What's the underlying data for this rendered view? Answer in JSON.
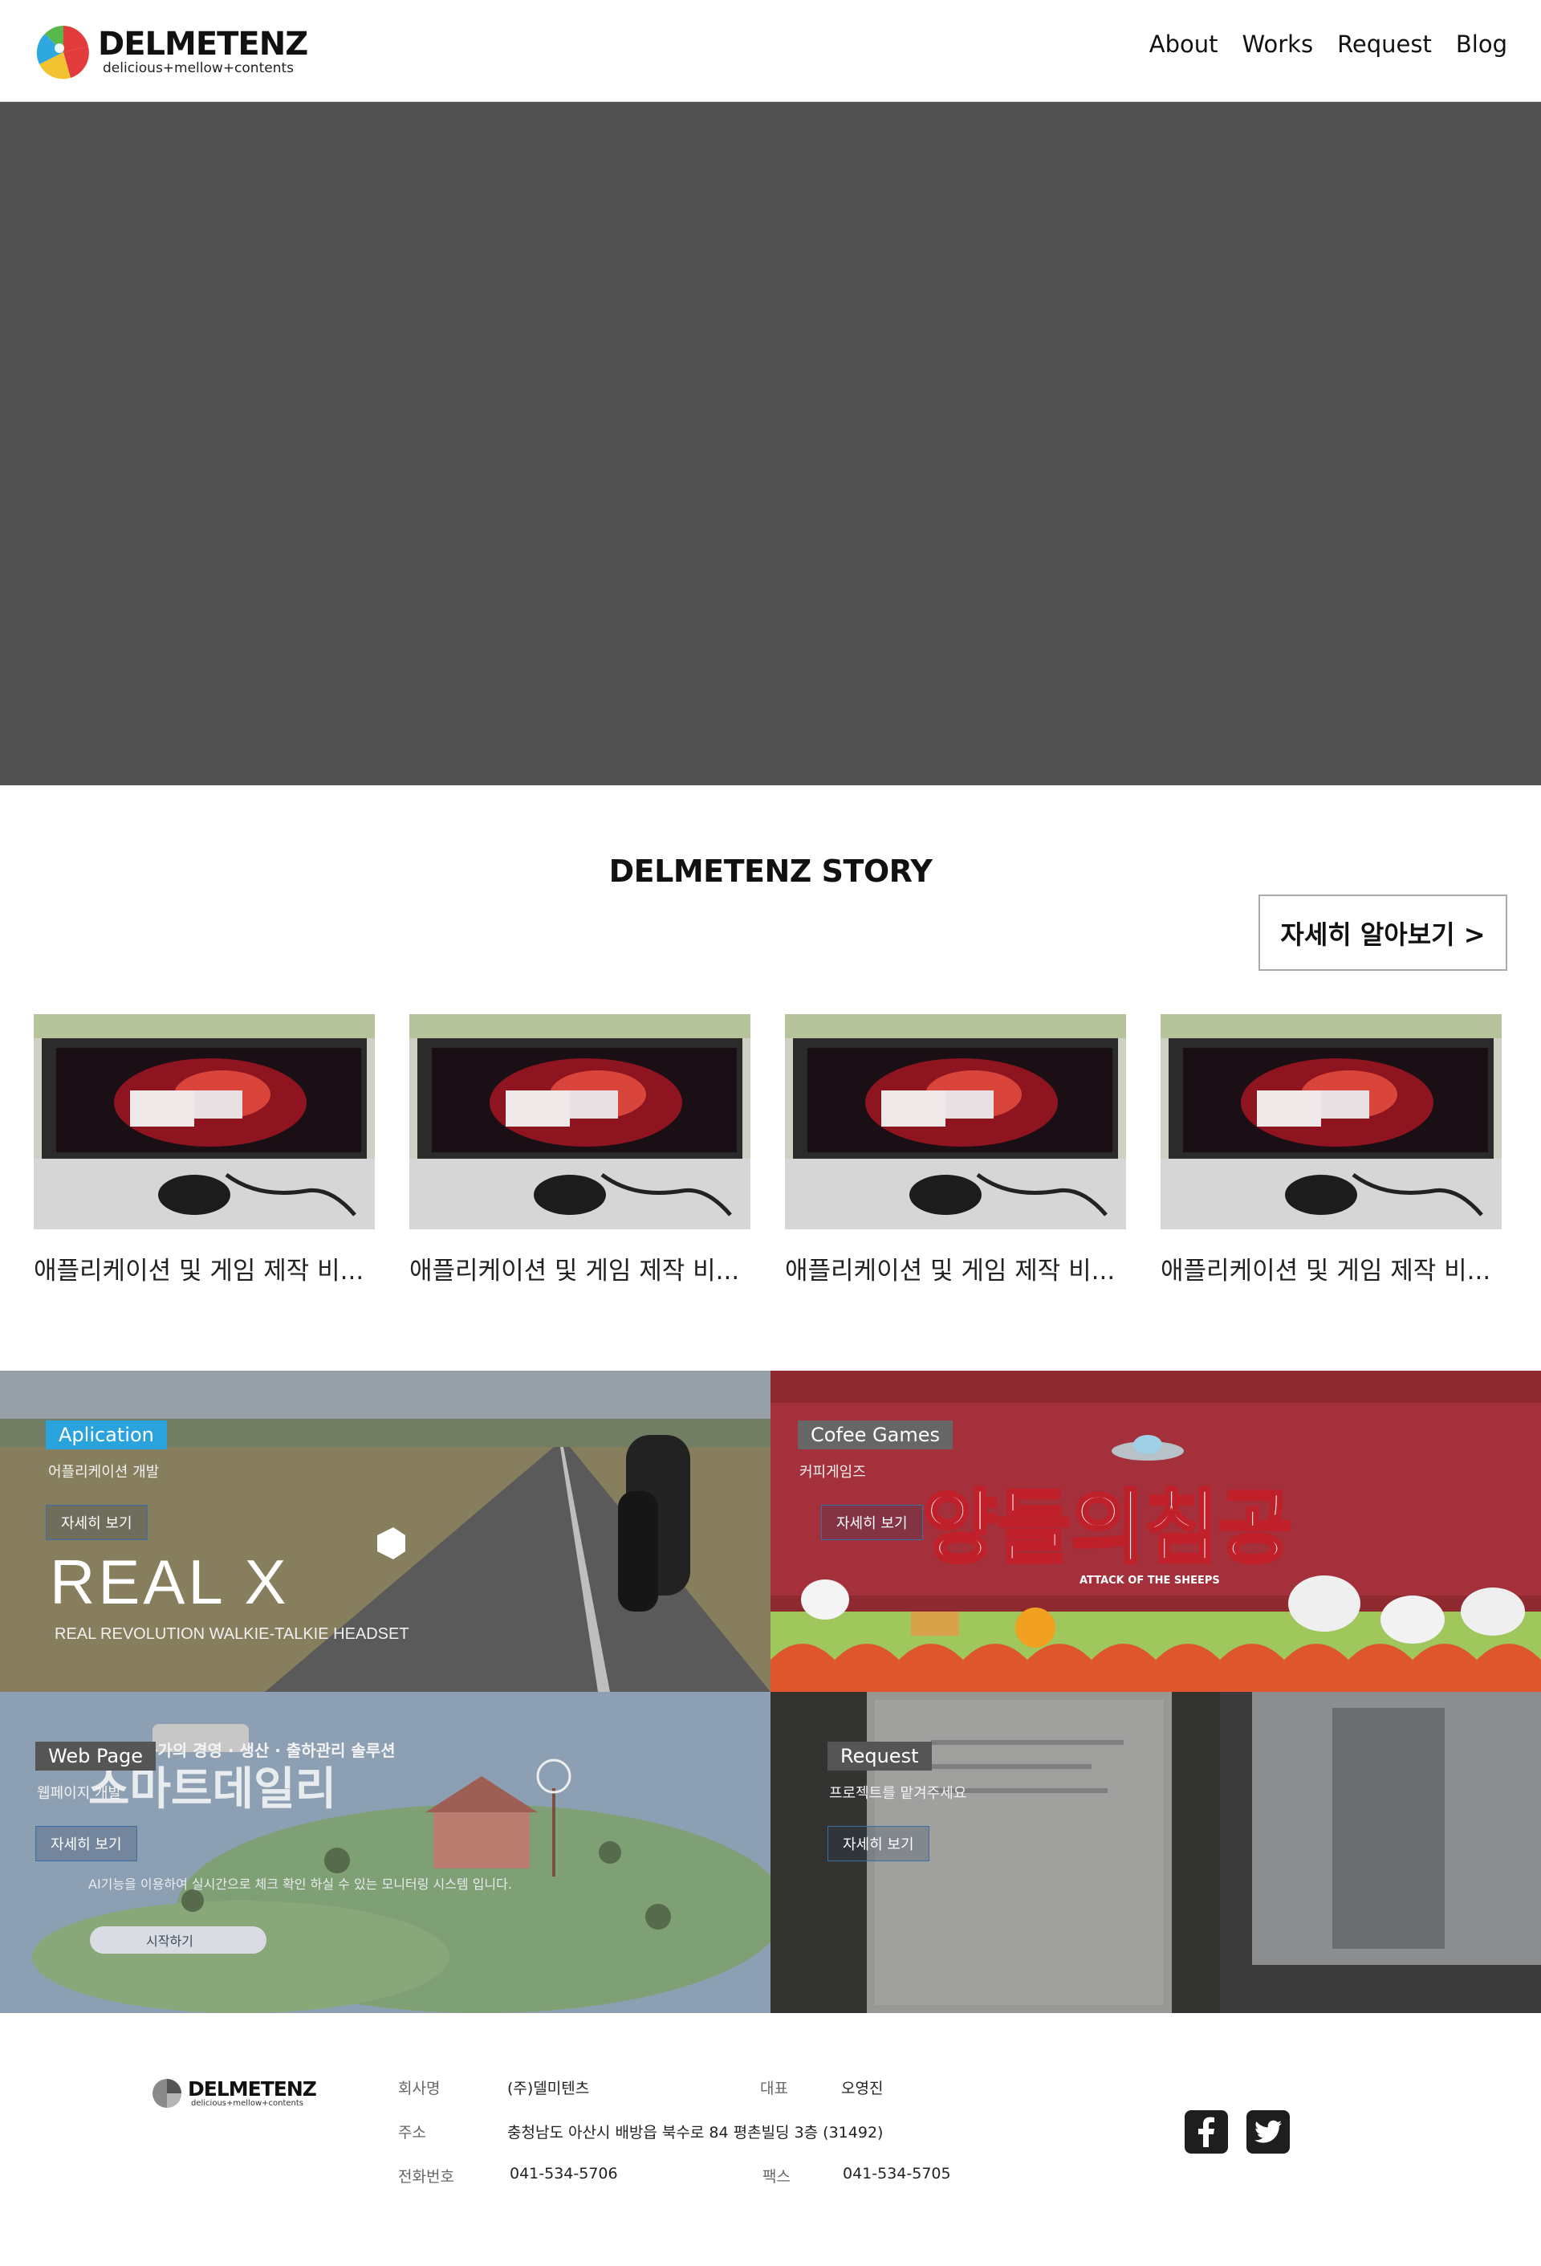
{
  "header": {
    "brand_name": "DELMETENZ",
    "brand_tagline": "delicious+mellow+contents",
    "nav": [
      {
        "label": "About"
      },
      {
        "label": "Works"
      },
      {
        "label": "Request"
      },
      {
        "label": "Blog"
      }
    ]
  },
  "story": {
    "title": "DELMETENZ STORY",
    "more_label": "자세히 알아보기 >",
    "cards": [
      {
        "title": "애플리케이션 및 게임 제작 비..."
      },
      {
        "title": "애플리케이션 및 게임 제작 비..."
      },
      {
        "title": "애플리케이션 및 게임 제작 비..."
      },
      {
        "title": "애플리케이션 및 게임 제작 비..."
      }
    ]
  },
  "tiles": [
    {
      "badge": "Aplication",
      "subtitle": "어플리케이션 개발",
      "button": "자세히 보기",
      "image_text": "REAL X",
      "image_subtext": "REAL REVOLUTION WALKIE-TALKIE HEADSET",
      "badge_color": "#2aa3dc"
    },
    {
      "badge": "Cofee Games",
      "subtitle": "커피게임즈",
      "button": "자세히 보기",
      "image_text": "양들의침공",
      "image_subtext": "ATTACK OF THE SHEEPS",
      "badge_color": "#666666"
    },
    {
      "badge": "Web Page",
      "subtitle": "웹페이지 개발",
      "button": "자세히 보기",
      "image_headline": "농가의 경영 · 생산 · 출하관리 솔루션",
      "image_text": "스마트데일리",
      "image_desc": "AI기능을 이용하여 실시간으로 체크 확인 하실 수 있는 모니터링 시스템 입니다.",
      "image_button": "시작하기",
      "badge_color": "#555555"
    },
    {
      "badge": "Request",
      "subtitle": "프로젝트를 맡겨주세요",
      "button": "자세히 보기",
      "badge_color": "#555555"
    }
  ],
  "footer": {
    "brand_name": "DELMETENZ",
    "brand_tagline": "delicious+mellow+contents",
    "company_label": "회사명",
    "company_value": "(주)델미텐츠",
    "ceo_label": "대표",
    "ceo_value": "오영진",
    "address_label": "주소",
    "address_value": "충청남도 아산시 배방읍 북수로 84 평촌빌딩 3층 (31492)",
    "phone_label": "전화번호",
    "phone_value": "041-534-5706",
    "fax_label": "팩스",
    "fax_value": "041-534-5705",
    "social": [
      {
        "icon": "facebook-icon"
      },
      {
        "icon": "twitter-icon"
      }
    ]
  },
  "colors": {
    "hero_bg": "#525252",
    "games_bg": "#8e2a2f",
    "accent_blue": "#2aa3dc"
  }
}
